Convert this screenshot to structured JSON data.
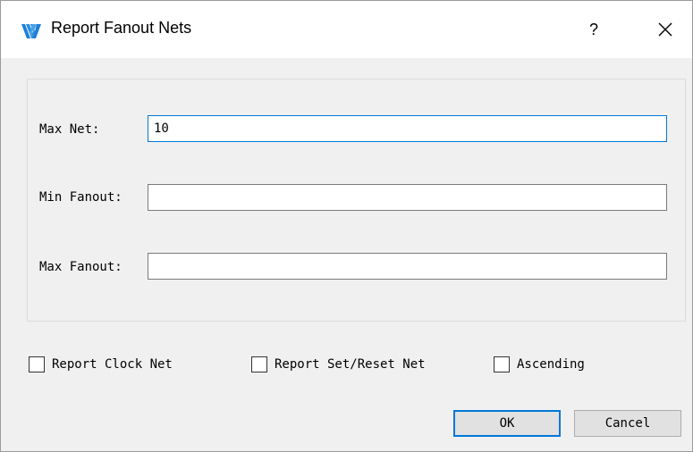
{
  "window": {
    "title": "Report Fanout Nets",
    "help_label": "?",
    "icons": {
      "app": "gowin-logo-icon",
      "close": "close-icon"
    },
    "accent_color": "#0078d7"
  },
  "form": {
    "max_net": {
      "label": "Max Net:",
      "value": "10",
      "placeholder": ""
    },
    "min_fanout": {
      "label": "Min Fanout:",
      "value": "",
      "placeholder": ""
    },
    "max_fanout": {
      "label": "Max Fanout:",
      "value": "",
      "placeholder": ""
    }
  },
  "options": {
    "report_clock_net": {
      "label": "Report Clock Net",
      "checked": false
    },
    "report_set_reset_net": {
      "label": "Report Set/Reset Net",
      "checked": false
    },
    "ascending": {
      "label": "Ascending",
      "checked": false
    }
  },
  "buttons": {
    "ok": "OK",
    "cancel": "Cancel"
  }
}
